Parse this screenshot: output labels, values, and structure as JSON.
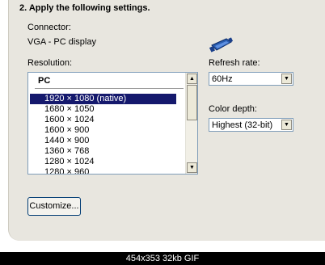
{
  "section": {
    "heading": "2. Apply the following settings."
  },
  "connector": {
    "label": "Connector:",
    "value": "VGA - PC display",
    "icon": "vga-connector-icon"
  },
  "resolution": {
    "label": "Resolution:",
    "group_header": "PC",
    "items": [
      "1920 × 1080 (native)",
      "1680 × 1050",
      "1600 × 1024",
      "1600 × 900",
      "1440 × 900",
      "1360 × 768",
      "1280 × 1024",
      "1280 × 960"
    ],
    "selected_index": 0
  },
  "refresh_rate": {
    "label": "Refresh rate:",
    "value": "60Hz"
  },
  "color_depth": {
    "label": "Color depth:",
    "value": "Highest (32-bit)"
  },
  "customize_button": {
    "label": "Customize..."
  },
  "caption": {
    "text": "454x353 32kb GIF"
  },
  "icons": {
    "scroll_up": "▲",
    "scroll_down": "▼",
    "dropdown": "▼"
  },
  "colors": {
    "selection": "#15196d",
    "panel": "#e8e6df",
    "input_border": "#7f9db9"
  }
}
